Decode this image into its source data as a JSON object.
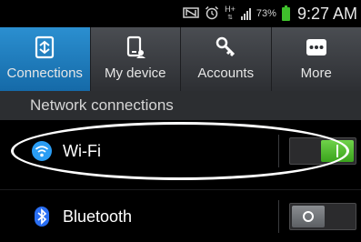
{
  "status_bar": {
    "network": "H+",
    "battery_percent": "73%",
    "time": "9:27 AM",
    "icons": [
      "nfc-icon",
      "alarm-icon",
      "network-type-icon",
      "signal-icon",
      "battery-icon"
    ]
  },
  "tabs": [
    {
      "label": "Connections",
      "icon": "connections-icon",
      "active": true
    },
    {
      "label": "My device",
      "icon": "device-icon",
      "active": false
    },
    {
      "label": "Accounts",
      "icon": "key-icon",
      "active": false
    },
    {
      "label": "More",
      "icon": "more-icon",
      "active": false
    }
  ],
  "section_header": "Network connections",
  "settings": [
    {
      "label": "Wi-Fi",
      "icon": "wifi-icon",
      "enabled": true
    },
    {
      "label": "Bluetooth",
      "icon": "bluetooth-icon",
      "enabled": false
    }
  ],
  "colors": {
    "active_tab": "#1e7fc0",
    "toggle_on": "#4cb82a",
    "wifi_icon": "#2a9df4",
    "bluetooth_icon": "#2a6ff4"
  }
}
